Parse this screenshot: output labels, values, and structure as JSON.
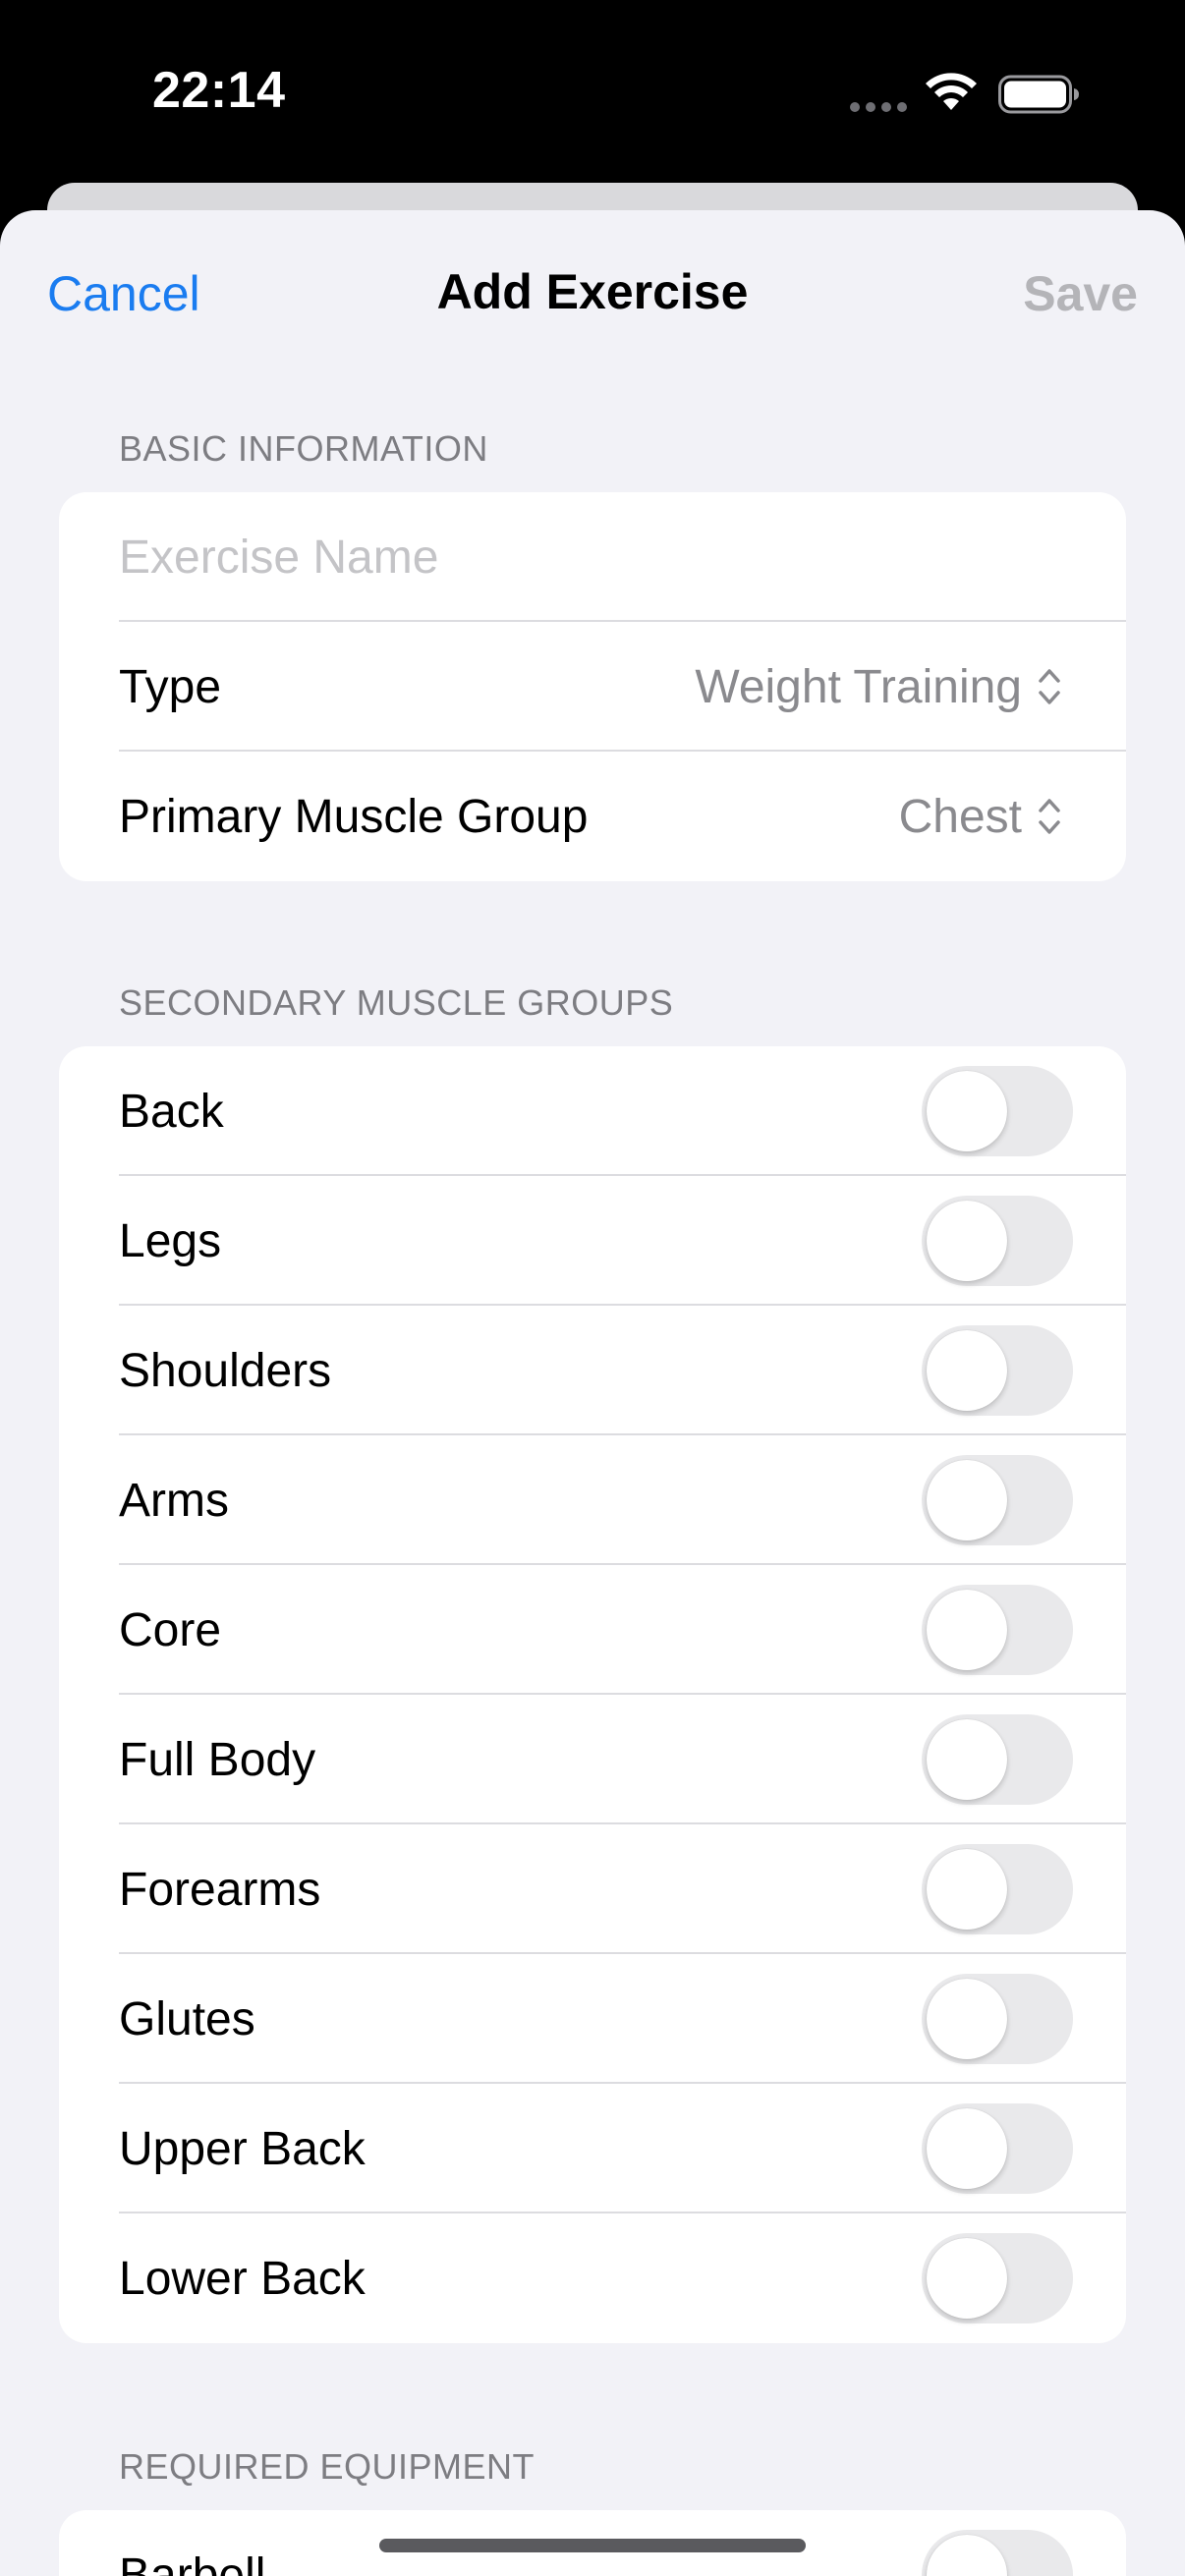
{
  "status": {
    "time": "22:14"
  },
  "nav": {
    "cancel": "Cancel",
    "title": "Add Exercise",
    "save": "Save"
  },
  "basic": {
    "header": "BASIC INFORMATION",
    "name_placeholder": "Exercise Name",
    "type_label": "Type",
    "type_value": "Weight Training",
    "primary_label": "Primary Muscle Group",
    "primary_value": "Chest"
  },
  "secondary": {
    "header": "SECONDARY MUSCLE GROUPS",
    "items": [
      {
        "label": "Back",
        "on": false
      },
      {
        "label": "Legs",
        "on": false
      },
      {
        "label": "Shoulders",
        "on": false
      },
      {
        "label": "Arms",
        "on": false
      },
      {
        "label": "Core",
        "on": false
      },
      {
        "label": "Full Body",
        "on": false
      },
      {
        "label": "Forearms",
        "on": false
      },
      {
        "label": "Glutes",
        "on": false
      },
      {
        "label": "Upper Back",
        "on": false
      },
      {
        "label": "Lower Back",
        "on": false
      }
    ]
  },
  "equipment": {
    "header": "REQUIRED EQUIPMENT",
    "items": [
      {
        "label": "Barbell",
        "on": false
      }
    ]
  },
  "colors": {
    "accent": "#1a7cf0",
    "background": "#f2f2f7",
    "toggle_off": "#e9e9eb",
    "disabled": "#b4b4b8"
  }
}
